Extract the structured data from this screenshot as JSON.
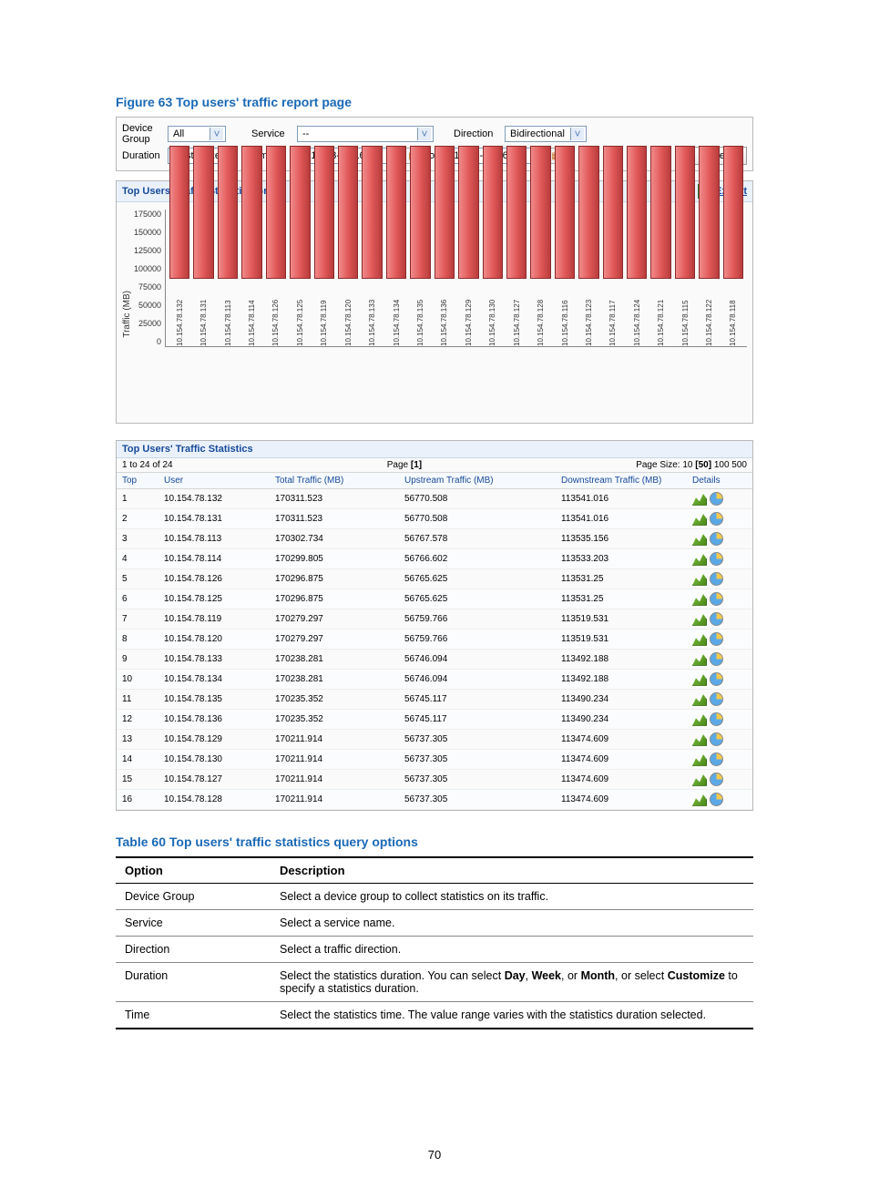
{
  "figure_caption": "Figure 63 Top users' traffic report page",
  "filter": {
    "device_group_label": "Device Group",
    "device_group_value": "All",
    "service_label": "Service",
    "service_value": "--",
    "direction_label": "Direction",
    "direction_value": "Bidirectional",
    "duration_label": "Duration",
    "duration_value": "Customize",
    "time_label": "Time",
    "time_from": "2010-03-28 16:00",
    "time_to_label": "to",
    "time_to": "2010-03-29 16:00",
    "query_button": "Query"
  },
  "graph": {
    "title": "Top Users' Traffic Statistics Graph",
    "export_label": "Export",
    "ylabel": "Traffic (MB)"
  },
  "chart_data": {
    "type": "bar",
    "ylabel": "Traffic (MB)",
    "ylim": [
      0,
      175000
    ],
    "yticks": [
      0,
      25000,
      50000,
      75000,
      100000,
      125000,
      150000,
      175000
    ],
    "categories": [
      "10.154.78.132",
      "10.154.78.131",
      "10.154.78.113",
      "10.154.78.114",
      "10.154.78.126",
      "10.154.78.125",
      "10.154.78.119",
      "10.154.78.120",
      "10.154.78.133",
      "10.154.78.134",
      "10.154.78.135",
      "10.154.78.136",
      "10.154.78.129",
      "10.154.78.130",
      "10.154.78.127",
      "10.154.78.128",
      "10.154.78.116",
      "10.154.78.123",
      "10.154.78.117",
      "10.154.78.124",
      "10.154.78.121",
      "10.154.78.115",
      "10.154.78.122",
      "10.154.78.118"
    ],
    "values": [
      170311,
      170311,
      170302,
      170299,
      170296,
      170296,
      170279,
      170279,
      170238,
      170238,
      170235,
      170235,
      170211,
      170211,
      170211,
      170211,
      170200,
      170200,
      170200,
      170200,
      170200,
      170200,
      170200,
      170200
    ]
  },
  "stats": {
    "title": "Top Users' Traffic Statistics",
    "pager_left": "1 to 24 of 24",
    "pager_center_prefix": "Page ",
    "pager_center_value": "[1]",
    "pager_right_prefix": "Page Size: 10 ",
    "pager_right_selected": "[50]",
    "pager_right_suffix": " 100 500",
    "headers": {
      "top": "Top",
      "user": "User",
      "total": "Total Traffic (MB)",
      "up": "Upstream Traffic (MB)",
      "down": "Downstream Traffic (MB)",
      "details": "Details"
    },
    "rows": [
      {
        "top": "1",
        "user": "10.154.78.132",
        "total": "170311.523",
        "up": "56770.508",
        "down": "113541.016"
      },
      {
        "top": "2",
        "user": "10.154.78.131",
        "total": "170311.523",
        "up": "56770.508",
        "down": "113541.016"
      },
      {
        "top": "3",
        "user": "10.154.78.113",
        "total": "170302.734",
        "up": "56767.578",
        "down": "113535.156"
      },
      {
        "top": "4",
        "user": "10.154.78.114",
        "total": "170299.805",
        "up": "56766.602",
        "down": "113533.203"
      },
      {
        "top": "5",
        "user": "10.154.78.126",
        "total": "170296.875",
        "up": "56765.625",
        "down": "113531.25"
      },
      {
        "top": "6",
        "user": "10.154.78.125",
        "total": "170296.875",
        "up": "56765.625",
        "down": "113531.25"
      },
      {
        "top": "7",
        "user": "10.154.78.119",
        "total": "170279.297",
        "up": "56759.766",
        "down": "113519.531"
      },
      {
        "top": "8",
        "user": "10.154.78.120",
        "total": "170279.297",
        "up": "56759.766",
        "down": "113519.531"
      },
      {
        "top": "9",
        "user": "10.154.78.133",
        "total": "170238.281",
        "up": "56746.094",
        "down": "113492.188"
      },
      {
        "top": "10",
        "user": "10.154.78.134",
        "total": "170238.281",
        "up": "56746.094",
        "down": "113492.188"
      },
      {
        "top": "11",
        "user": "10.154.78.135",
        "total": "170235.352",
        "up": "56745.117",
        "down": "113490.234"
      },
      {
        "top": "12",
        "user": "10.154.78.136",
        "total": "170235.352",
        "up": "56745.117",
        "down": "113490.234"
      },
      {
        "top": "13",
        "user": "10.154.78.129",
        "total": "170211.914",
        "up": "56737.305",
        "down": "113474.609"
      },
      {
        "top": "14",
        "user": "10.154.78.130",
        "total": "170211.914",
        "up": "56737.305",
        "down": "113474.609"
      },
      {
        "top": "15",
        "user": "10.154.78.127",
        "total": "170211.914",
        "up": "56737.305",
        "down": "113474.609"
      },
      {
        "top": "16",
        "user": "10.154.78.128",
        "total": "170211.914",
        "up": "56737.305",
        "down": "113474.609"
      }
    ]
  },
  "table_caption": "Table 60 Top users' traffic statistics query options",
  "options": {
    "headers": {
      "option": "Option",
      "description": "Description"
    },
    "rows": [
      {
        "opt": "Device Group",
        "desc_plain": "Select a device group to collect statistics on its traffic."
      },
      {
        "opt": "Service",
        "desc_plain": "Select a service name."
      },
      {
        "opt": "Direction",
        "desc_plain": "Select a traffic direction."
      },
      {
        "opt": "Duration",
        "desc_parts": {
          "p1": "Select the statistics duration. You can select ",
          "b1": "Day",
          "p2": ", ",
          "b2": "Week",
          "p3": ", or ",
          "b3": "Month",
          "p4": ", or select ",
          "b4": "Customize",
          "p5": " to specify a statistics duration."
        }
      },
      {
        "opt": "Time",
        "desc_plain": "Select the statistics time. The value range varies with the statistics duration selected."
      }
    ]
  },
  "page_number": "70"
}
